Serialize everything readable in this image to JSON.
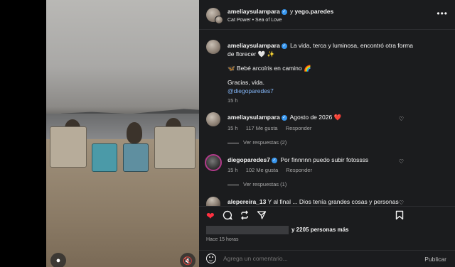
{
  "header": {
    "author": "ameliaysulampara",
    "connector": "y",
    "coauthor": "yego.paredes",
    "audio": "Cat Power • Sea of Love",
    "menu_icon": "more-horizontal-icon"
  },
  "caption": {
    "author": "ameliaysulampara",
    "line1": "La vida, terca y luminosa, encontró otra forma de florecer 🤍 ✨",
    "line2": "🦋 Bebé arcoíris en camino 🌈",
    "line3": "Gracias, vida.",
    "mention": "@diegoparedes7",
    "time": "15 h"
  },
  "comments": [
    {
      "author": "ameliaysulampara",
      "text": "Agosto de 2026 ❤️",
      "time": "15 h",
      "likes": "117 Me gusta",
      "reply": "Responder",
      "view_replies": "Ver respuestas (2)"
    },
    {
      "author": "diegoparedes7",
      "text": "Por finnnnn puedo subir fotossss",
      "time": "15 h",
      "likes": "102 Me gusta",
      "reply": "Responder",
      "view_replies": "Ver respuestas (1)"
    },
    {
      "author": "alepereira_13",
      "text": "Y al final ... Dios tenía grandes cosas y personas"
    }
  ],
  "likes_text": "y 2205 personas más",
  "time_ago": "Hace 15 horas",
  "comment_input": {
    "placeholder": "Agrega un comentario..."
  },
  "publish_label": "Publicar",
  "colors": {
    "panel_bg": "#1b1c1e",
    "verified": "#3897f0",
    "like_red": "#ff3040",
    "link": "#82b4f5"
  }
}
